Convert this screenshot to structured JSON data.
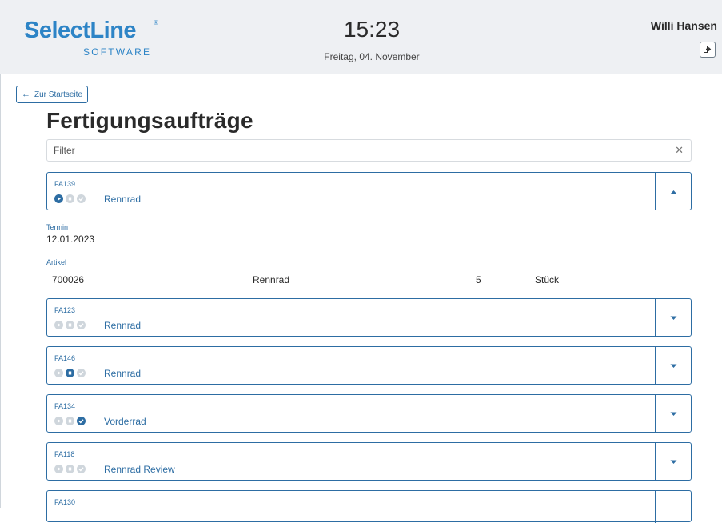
{
  "header": {
    "logo": "SelectLine",
    "logo_registered": "®",
    "logo_sub": "SOFTWARE",
    "time": "15:23",
    "date": "Freitag, 04. November",
    "user": "Willi Hansen"
  },
  "nav": {
    "back_label": "Zur Startseite"
  },
  "page": {
    "title": "Fertigungsaufträge"
  },
  "filter": {
    "placeholder": "Filter",
    "value": ""
  },
  "orders": [
    {
      "number": "FA139",
      "name": "Rennrad",
      "status": "started",
      "expanded": true
    },
    {
      "number": "FA123",
      "name": "Rennrad",
      "status": "none",
      "expanded": false
    },
    {
      "number": "FA146",
      "name": "Rennrad",
      "status": "paused",
      "expanded": false
    },
    {
      "number": "FA134",
      "name": "Vorderrad",
      "status": "done",
      "expanded": false
    },
    {
      "number": "FA118",
      "name": "Rennrad Review",
      "status": "none",
      "expanded": false
    },
    {
      "number": "FA130",
      "name": "",
      "status": "none",
      "expanded": false
    }
  ],
  "detail": {
    "termin_label": "Termin",
    "termin_value": "12.01.2023",
    "artikel_label": "Artikel",
    "artikel_number": "700026",
    "artikel_name": "Rennrad",
    "artikel_qty": "5",
    "artikel_unit": "Stück"
  },
  "colors": {
    "accent": "#2d6da3",
    "brand": "#2d84c6",
    "header_bg": "#eef0f3",
    "inactive_icon": "#cfd6dc"
  },
  "icons": {
    "status_start": "play-icon",
    "status_pause": "pause-icon",
    "status_done": "check-icon",
    "expanded": "chevron-up-icon",
    "collapsed": "chevron-down-icon",
    "filter_clear": "close-icon",
    "logout": "logout-icon",
    "back": "arrow-left-icon"
  }
}
